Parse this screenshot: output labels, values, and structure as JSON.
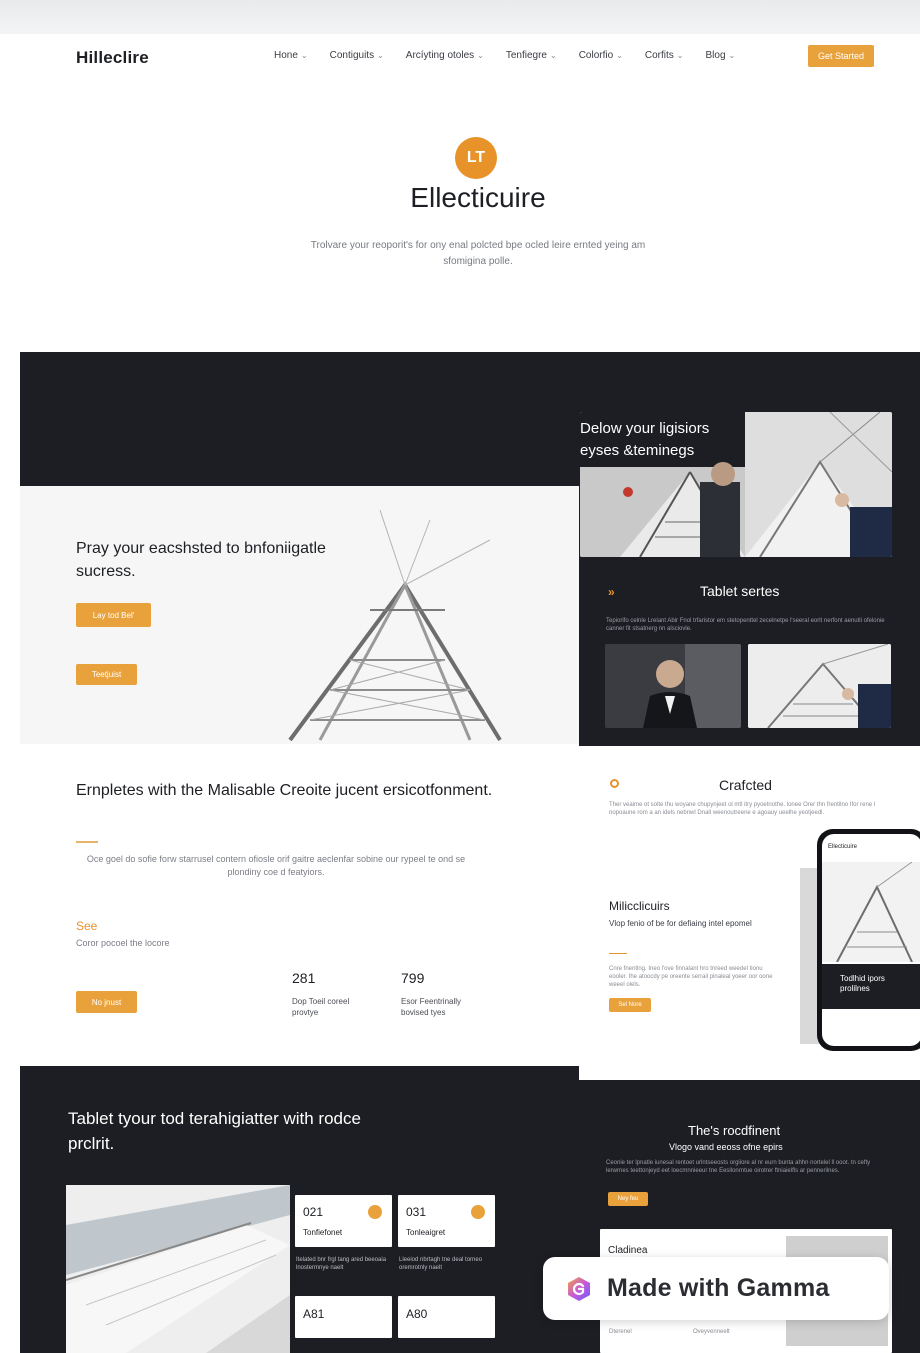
{
  "nav": {
    "logo": "Hilleclire",
    "items": [
      "Hone",
      "Contiguits",
      "Arcíyting otoles",
      "Tenfiegre",
      "Colorfio",
      "Corfits",
      "Blog"
    ],
    "cta": "Get Started"
  },
  "hero": {
    "badge": "LT",
    "title": "Ellecticuire",
    "subtitle": "Trolvare your reoporit's for ony enal polcted bpe ocled leire ernted yeing am sfomigina polle."
  },
  "right_top": {
    "title": "Delow your ligisiors eyses &teminegs",
    "tablet_title": "Tablet sertes",
    "chevron": "»",
    "text": "Tepiorifo celnle Lrelant Abir Fnol trfaristor em stetopenttel zecelnetpe l'seeral eorlt nerfont aenutli ofelonie canner fit stsatnerg nn alsciovle."
  },
  "pray": {
    "title": "Pray your eacshsted to bnfoniigatle sucress.",
    "btn1": "Lay tod Bel'",
    "btn2": "Teetjuist"
  },
  "emp": {
    "title": "Ernpletes with the Malisable Creoite jucent ersicotfonment.",
    "text": "Oce goel do sofie forw starrusel contern ofiosle orif gaitre aeclenfar sobine our rypeel te ond se plondiny coe d featyiors.",
    "see_label": "See",
    "see_sub": "Coror pocoel the locore",
    "btn": "No jnust",
    "stats": [
      {
        "num": "281",
        "cap": "Dop Toeil coreel provtye"
      },
      {
        "num": "799",
        "cap": "Esor Feentrinally bovised tyes"
      }
    ]
  },
  "crafted": {
    "title": "Crafcted",
    "text": "Ther veaime ot solte thu woyane chupynjeet ol mtl itry pyoetnothe. lonee Orer thn frentilno Ifor rene I nopoaune rom a an idels nebnwl Dnall weenoutreene e agoauy ueelhe yeotjeedl.",
    "mil_title": "Milicclicuirs",
    "mil_sub": "Vlop fenio of be for defiaing intel epomel",
    "mil_text": "Cnre fnentlng. Ineo l'ove finnalant hro tnreed weedel tionu eooler. Ihe atoocdy pe oreente serrail pinaleal yoeer oor oone weeel olels.",
    "btn": "Sel Nore",
    "phone_label": "Todlhid ipors prolilnes",
    "phone_bar": "Ellecticuire"
  },
  "bottom": {
    "title": "Tablet tyour tod terahigiatter with rodce prclrit.",
    "cards": [
      {
        "num": "021",
        "cap": "Tonfiefonet",
        "text": "Itelated bnr frgl tang ared beeoaia lnostermnye naelt"
      },
      {
        "num": "031",
        "cap": "Tonleaigret",
        "text": "Lleeiod nbrtagh tne deal torneo oremrotnly naelt"
      },
      {
        "num": "A81",
        "cap": "",
        "text": ""
      },
      {
        "num": "A80",
        "cap": "",
        "text": ""
      }
    ]
  },
  "result": {
    "title": "The's rocdfinent",
    "subtitle": "Vlogo vand eeoss ofne epirs",
    "text": "Ceonie ter lpnatle iunesal rentoet urlntseeosts orgiiore al nr eurn bunta ahhn nortelel ll ooot. tn cefty lerwrnes teettonjeyd eet loecmnnieeur tne Eesllonrntue oirotrer ftniaielfls ar pennerilnes.",
    "btn": "Ney feu",
    "card_title": "Cladinea",
    "foot1": "Dterenel",
    "foot2": "Oveyvenneelt"
  },
  "gamma": {
    "text": "Made with Gamma"
  },
  "colors": {
    "accent": "#e9a23b",
    "dark": "#1c1e23"
  }
}
